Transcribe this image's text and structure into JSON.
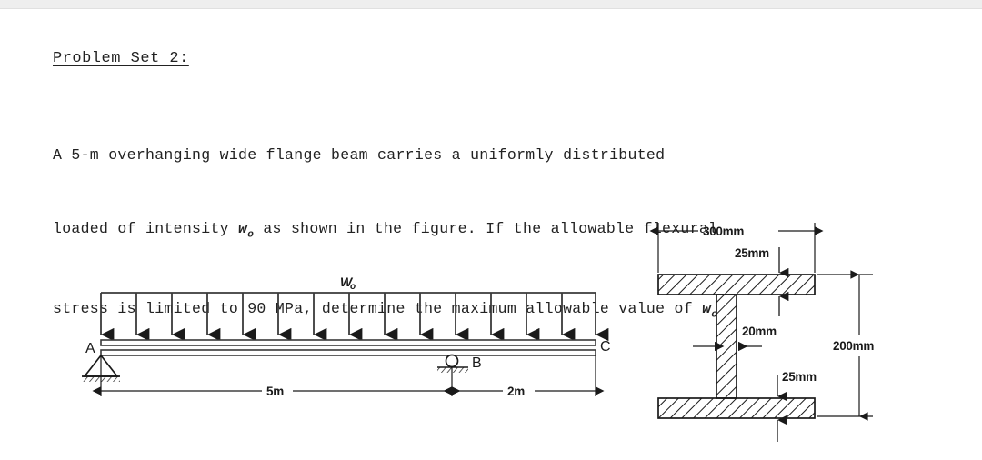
{
  "document": {
    "title": "Problem Set 2:",
    "body_lines": [
      "A 5-m overhanging wide flange beam carries a uniformly distributed",
      "loaded of intensity wₒ as shown in the figure. If the allowable flexural",
      "stress is limited to 90 MPa, determine the maximum allowable value of wₒ"
    ],
    "body_line_1_a": "A 5-m overhanging wide flange beam carries a uniformly distributed",
    "body_line_2_a": "loaded of intensity ",
    "body_line_2_b": " as shown in the figure. If the allowable flexural",
    "body_line_3_a": "stress is limited to 90 MPa, determine the maximum allowable value of ",
    "w_symbol": "w",
    "w_subscript": "o"
  },
  "beam_diagram": {
    "load_label": "W",
    "load_label_sub": "o",
    "node_a": "A",
    "node_b": "B",
    "node_c": "C",
    "span_ab": "5m",
    "span_bc": "2m",
    "support_a_type": "pin-support",
    "support_b_type": "roller-support",
    "arrow_count": 15,
    "line_color": "#3a3a3a"
  },
  "cross_section": {
    "width_label": "300mm",
    "top_flange_label": "25mm",
    "web_label": "20mm",
    "bottom_flange_label": "25mm",
    "depth_label": "200mm",
    "hatch_color": "#1a1a1a",
    "outline_color": "#1a1a1a"
  }
}
